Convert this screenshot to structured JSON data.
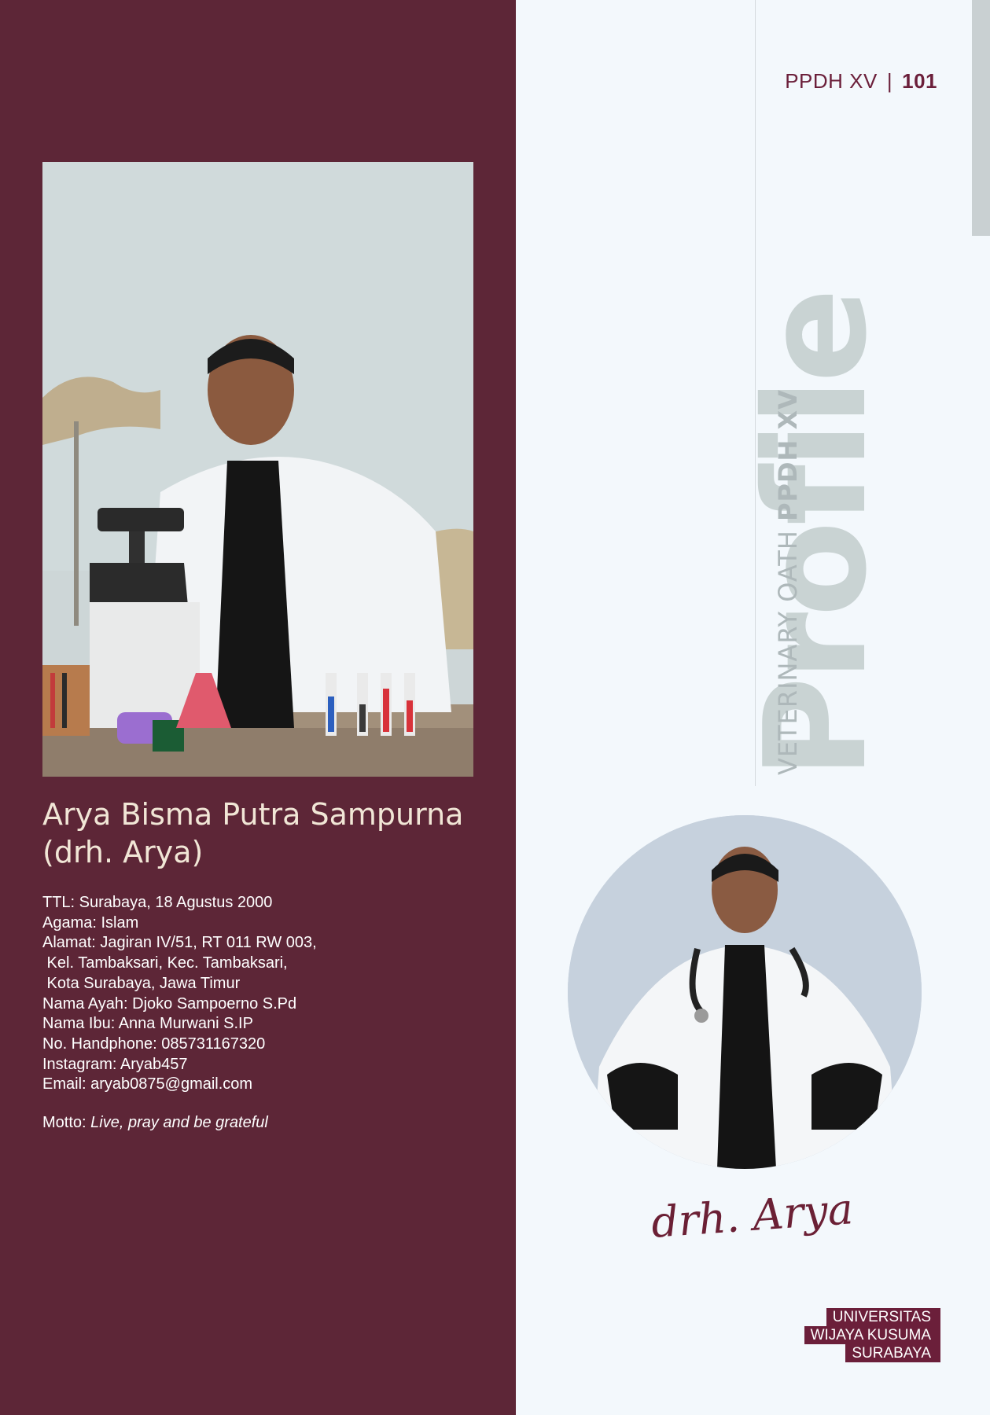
{
  "header": {
    "series": "PPDH XV",
    "separator": "|",
    "page_number": "101"
  },
  "profile": {
    "big_word": "Profile",
    "vertical_caption_light": "VETERINARY OATH ",
    "vertical_caption_bold": "PPDH XV"
  },
  "person": {
    "name_line1": "Arya Bisma Putra Sampurna",
    "name_line2": "(drh. Arya)",
    "details": [
      "TTL: Surabaya, 18 Agustus 2000",
      "Agama: Islam",
      "Alamat: Jagiran IV/51, RT 011 RW 003,",
      " Kel. Tambaksari, Kec. Tambaksari,",
      " Kota Surabaya, Jawa Timur",
      "Nama Ayah: Djoko Sampoerno S.Pd",
      "Nama Ibu: Anna Murwani S.IP",
      "No. Handphone: 085731167320",
      "Instagram: Aryab457",
      "Email: aryab0875@gmail.com"
    ],
    "motto_label": "Motto: ",
    "motto_text": "Live, pray and be grateful",
    "signature": "drh. Arya"
  },
  "logo": {
    "line1": "UNIVERSITAS",
    "line2": "WIJAYA KUSUMA",
    "line3": "SURABAYA"
  },
  "colors": {
    "panel": "#5d2637",
    "accent": "#6b1f3a",
    "background": "#f3f8fc",
    "watermark": "#c9d3d3"
  }
}
